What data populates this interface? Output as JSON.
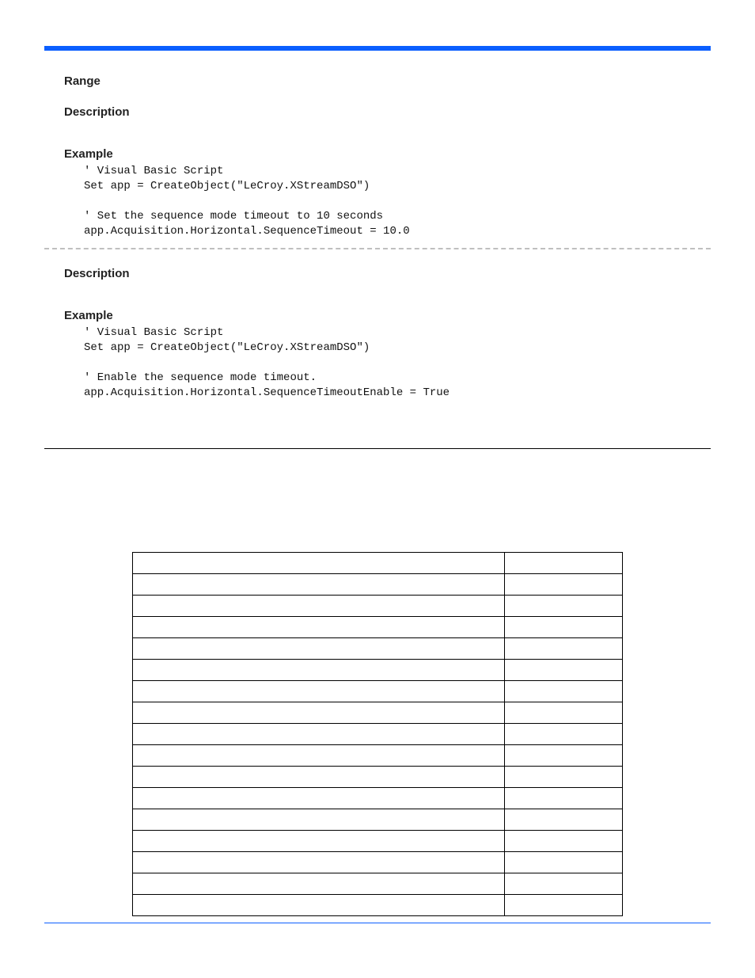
{
  "section1": {
    "range_label": "Range",
    "description_label": "Description",
    "example_label": "Example",
    "code": "' Visual Basic Script\nSet app = CreateObject(\"LeCroy.XStreamDSO\")\n\n' Set the sequence mode timeout to 10 seconds\napp.Acquisition.Horizontal.SequenceTimeout = 10.0"
  },
  "section2": {
    "description_label": "Description",
    "example_label": "Example",
    "code": "' Visual Basic Script\nSet app = CreateObject(\"LeCroy.XStreamDSO\")\n\n' Enable the sequence mode timeout.\napp.Acquisition.Horizontal.SequenceTimeoutEnable = True"
  },
  "table": {
    "rows": [
      {
        "c1": "",
        "c2": ""
      },
      {
        "c1": "",
        "c2": ""
      },
      {
        "c1": "",
        "c2": ""
      },
      {
        "c1": "",
        "c2": ""
      },
      {
        "c1": "",
        "c2": ""
      },
      {
        "c1": "",
        "c2": ""
      },
      {
        "c1": "",
        "c2": ""
      },
      {
        "c1": "",
        "c2": ""
      },
      {
        "c1": "",
        "c2": ""
      },
      {
        "c1": "",
        "c2": ""
      },
      {
        "c1": "",
        "c2": ""
      },
      {
        "c1": "",
        "c2": ""
      },
      {
        "c1": "",
        "c2": ""
      },
      {
        "c1": "",
        "c2": ""
      },
      {
        "c1": "",
        "c2": ""
      },
      {
        "c1": "",
        "c2": ""
      },
      {
        "c1": "",
        "c2": ""
      }
    ]
  }
}
